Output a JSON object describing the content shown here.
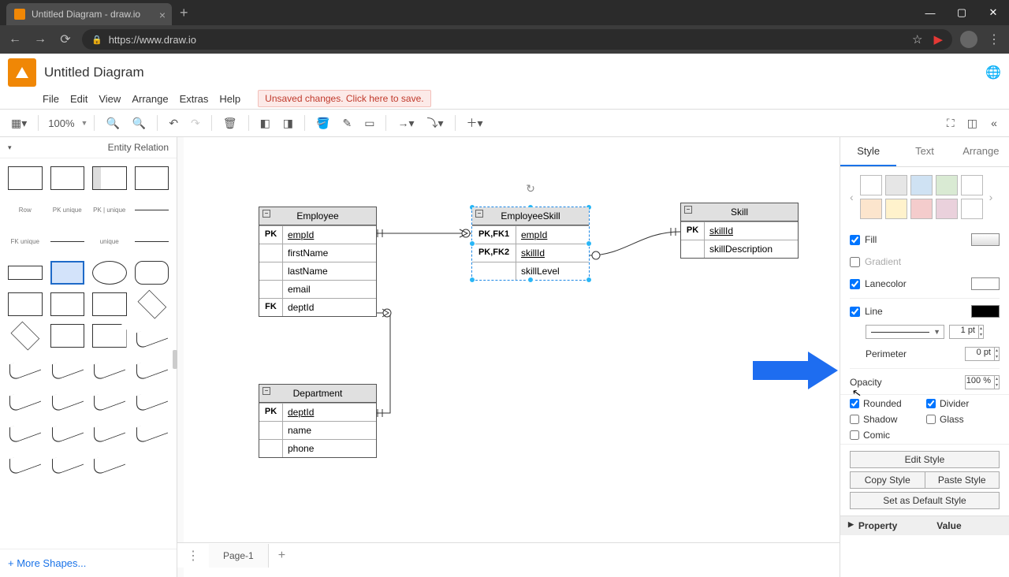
{
  "browser": {
    "tab_title": "Untitled Diagram - draw.io",
    "url": "https://www.draw.io"
  },
  "app": {
    "title": "Untitled Diagram",
    "menu": [
      "File",
      "Edit",
      "View",
      "Arrange",
      "Extras",
      "Help"
    ],
    "unsaved_msg": "Unsaved changes. Click here to save."
  },
  "toolbar": {
    "zoom": "100%"
  },
  "palette": {
    "title": "Entity Relation",
    "more": "+ More Shapes..."
  },
  "canvas": {
    "tables": {
      "employee": {
        "title": "Employee",
        "rows": [
          {
            "key": "PK",
            "val": "empId",
            "u": true
          },
          {
            "key": "",
            "val": "firstName"
          },
          {
            "key": "",
            "val": "lastName"
          },
          {
            "key": "",
            "val": "email"
          },
          {
            "key": "FK",
            "val": "deptId"
          }
        ]
      },
      "employeeSkill": {
        "title": "EmployeeSkill",
        "rows": [
          {
            "key": "PK,FK1",
            "val": "empId",
            "u": true
          },
          {
            "key": "PK,FK2",
            "val": "skillId",
            "u": true
          },
          {
            "key": "",
            "val": "skillLevel"
          }
        ]
      },
      "skill": {
        "title": "Skill",
        "rows": [
          {
            "key": "PK",
            "val": "skillId",
            "u": true
          },
          {
            "key": "",
            "val": "skillDescription"
          }
        ]
      },
      "department": {
        "title": "Department",
        "rows": [
          {
            "key": "PK",
            "val": "deptId",
            "u": true
          },
          {
            "key": "",
            "val": "name"
          },
          {
            "key": "",
            "val": "phone"
          }
        ]
      }
    }
  },
  "rpanel": {
    "tabs": {
      "style": "Style",
      "text": "Text",
      "arrange": "Arrange"
    },
    "swatches": [
      "#ffffff",
      "#e6e6e6",
      "#cfe2f3",
      "#d9ead3",
      "#fce5cd",
      "#f4cccc",
      "#ead1dc",
      "#d9d2e9"
    ],
    "fill_label": "Fill",
    "gradient_label": "Gradient",
    "lanecolor_label": "Lanecolor",
    "line_label": "Line",
    "line_width": "1 pt",
    "perimeter_label": "Perimeter",
    "perimeter_val": "0 pt",
    "opacity_label": "Opacity",
    "opacity_val": "100 %",
    "rounded": "Rounded",
    "divider": "Divider",
    "shadow": "Shadow",
    "glass": "Glass",
    "comic": "Comic",
    "edit_style": "Edit Style",
    "copy_style": "Copy Style",
    "paste_style": "Paste Style",
    "set_default": "Set as Default Style",
    "prop": "Property",
    "val": "Value"
  },
  "pages": {
    "p1": "Page-1"
  }
}
